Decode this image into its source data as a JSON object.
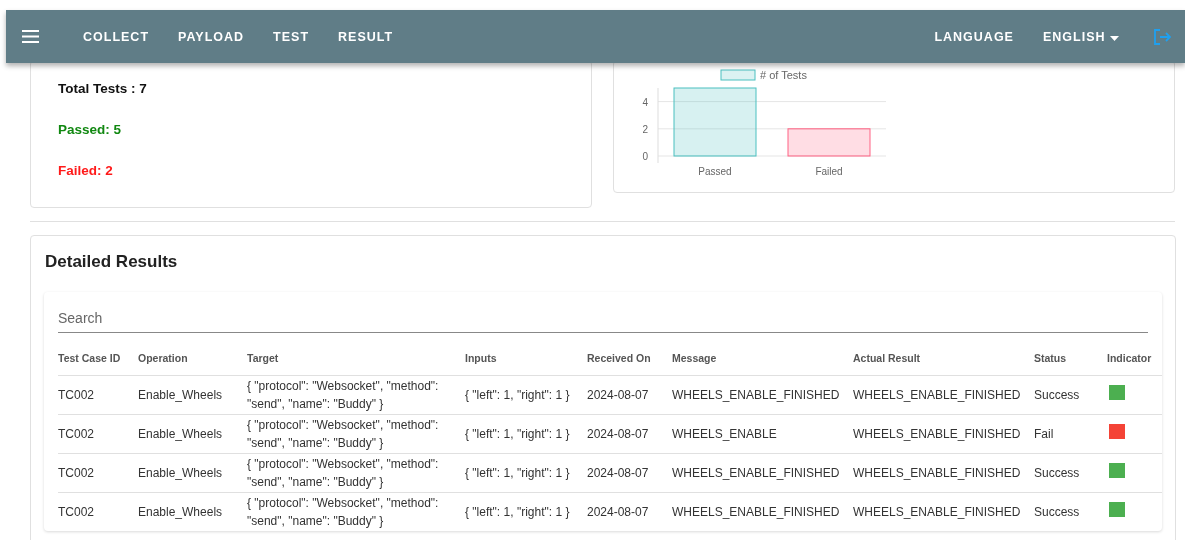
{
  "nav": {
    "items": [
      "COLLECT",
      "PAYLOAD",
      "TEST",
      "RESULT"
    ],
    "language_label": "LANGUAGE",
    "language": "ENGLISH"
  },
  "summary": {
    "total": "Total Tests : 7",
    "passed": "Passed: 5",
    "failed": "Failed: 2"
  },
  "chart": {
    "chart_data": {
      "type": "bar",
      "categories": [
        "Passed",
        "Failed"
      ],
      "series": [
        {
          "name": "# of Tests",
          "color": "#4bc0c0",
          "colors": [
            "#4bc0c0",
            "#ff6384"
          ],
          "values": [
            5,
            2
          ]
        }
      ],
      "ylim": [
        0,
        5
      ],
      "yticks": [
        0,
        2,
        4
      ]
    }
  },
  "results": {
    "title": "Detailed Results",
    "search": {
      "placeholder": "Search"
    },
    "columns": [
      "Test Case ID",
      "Operation",
      "Target",
      "Inputs",
      "Received On",
      "Message",
      "Actual Result",
      "Status",
      "Indicator"
    ],
    "rows": [
      {
        "cells": [
          "TC002",
          "Enable_Wheels",
          "{ \"protocol\": \"Websocket\", \"method\": \"send\", \"name\": \"Buddy\" }",
          "{ \"left\": 1, \"right\": 1 }",
          "2024-08-07",
          "WHEELS_ENABLE_FINISHED",
          "WHEELS_ENABLE_FINISHED",
          "Success"
        ],
        "color": "#4caf50"
      },
      {
        "cells": [
          "TC002",
          "Enable_Wheels",
          "{ \"protocol\": \"Websocket\", \"method\": \"send\", \"name\": \"Buddy\" }",
          "{ \"left\": 1, \"right\": 1 }",
          "2024-08-07",
          "WHEELS_ENABLE",
          "WHEELS_ENABLE_FINISHED",
          "Fail"
        ],
        "color": "#f44336"
      },
      {
        "cells": [
          "TC002",
          "Enable_Wheels",
          "{ \"protocol\": \"Websocket\", \"method\": \"send\", \"name\": \"Buddy\" }",
          "{ \"left\": 1, \"right\": 1 }",
          "2024-08-07",
          "WHEELS_ENABLE_FINISHED",
          "WHEELS_ENABLE_FINISHED",
          "Success"
        ],
        "color": "#4caf50"
      },
      {
        "cells": [
          "TC002",
          "Enable_Wheels",
          "{ \"protocol\": \"Websocket\", \"method\": \"send\", \"name\": \"Buddy\" }",
          "{ \"left\": 1, \"right\": 1 }",
          "2024-08-07",
          "WHEELS_ENABLE_FINISHED",
          "WHEELS_ENABLE_FINISHED",
          "Success"
        ],
        "color": "#4caf50"
      }
    ]
  }
}
